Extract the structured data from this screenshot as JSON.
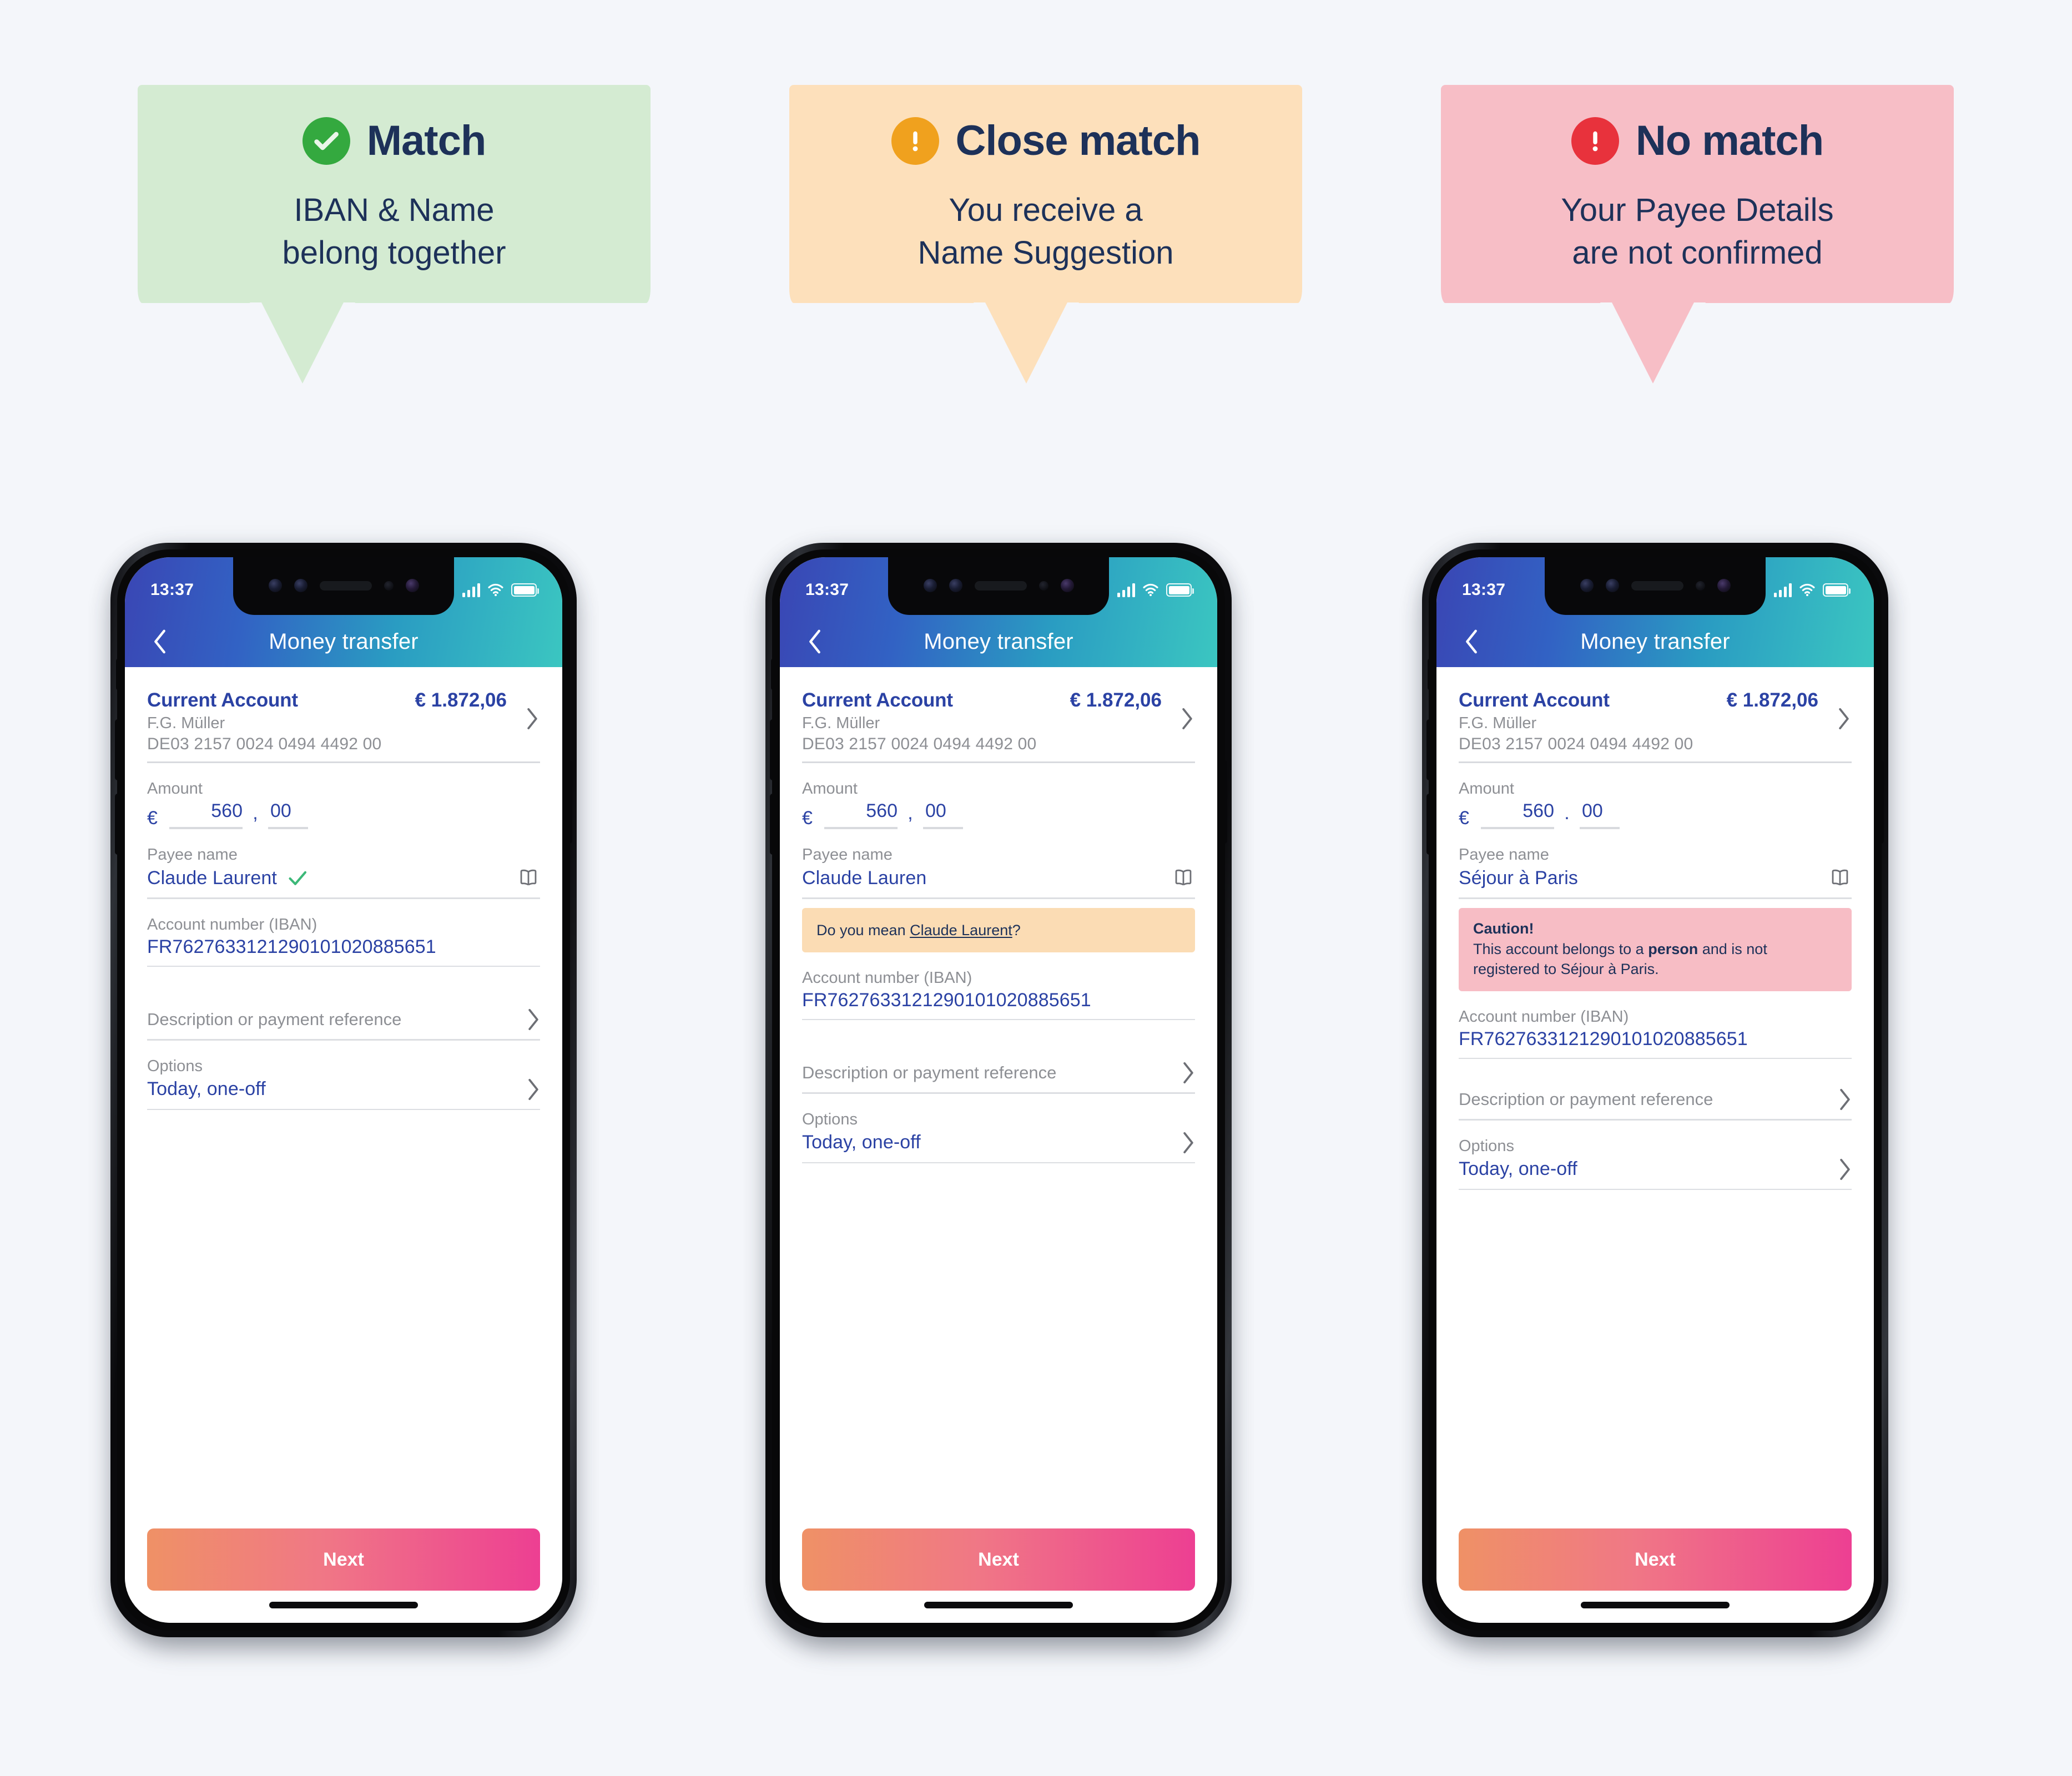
{
  "page": {
    "background_color": "#f4f6fa"
  },
  "callouts": [
    {
      "id": "match",
      "title": "Match",
      "subtitle_line1": "IBAN & Name",
      "subtitle_line2": "belong together",
      "icon": "check-circle-icon",
      "badge_color": "#34a93f",
      "panel_color": "#d4ebd2",
      "text_color": "#1d3159"
    },
    {
      "id": "close-match",
      "title": "Close match",
      "subtitle_line1": "You receive a",
      "subtitle_line2": "Name Suggestion",
      "icon": "exclamation-circle-icon",
      "badge_color": "#f0a11e",
      "panel_color": "#fde0bb",
      "text_color": "#1d3159"
    },
    {
      "id": "no-match",
      "title": "No match",
      "subtitle_line1": "Your Payee Details",
      "subtitle_line2": "are not confirmed",
      "icon": "exclamation-circle-icon",
      "badge_color": "#e8323c",
      "panel_color": "#f7bec6",
      "text_color": "#1d3159"
    }
  ],
  "phones": [
    {
      "id": "phone-match",
      "status_bar": {
        "time": "13:37",
        "signal_icon": "cellular-signal-icon",
        "wifi_icon": "wifi-icon",
        "battery_icon": "battery-full-icon"
      },
      "header": {
        "back_icon": "chevron-left-icon",
        "title": "Money transfer"
      },
      "account": {
        "name": "Current Account",
        "balance": "€ 1.872,06",
        "holder": "F.G. Müller",
        "iban": "DE03 2157 0024 0494 4492 00",
        "chevron_icon": "chevron-right-icon"
      },
      "amount": {
        "label": "Amount",
        "currency": "€",
        "integer": "560",
        "separator": ",",
        "decimals": "00"
      },
      "payee": {
        "label": "Payee name",
        "value": "Claude Laurent",
        "status_icon": "check-icon",
        "status_icon_color": "#3cb878",
        "addressbook_icon": "open-book-icon"
      },
      "alert": null,
      "iban_field": {
        "label": "Account number (IBAN)",
        "value": "FR7627633121290101020885651"
      },
      "description_field": {
        "placeholder": "Description or payment reference",
        "chevron_icon": "chevron-right-icon"
      },
      "options_field": {
        "label": "Options",
        "value": "Today, one-off",
        "chevron_icon": "chevron-right-icon"
      },
      "primary_button": "Next"
    },
    {
      "id": "phone-close-match",
      "status_bar": {
        "time": "13:37",
        "signal_icon": "cellular-signal-icon",
        "wifi_icon": "wifi-icon",
        "battery_icon": "battery-full-icon"
      },
      "header": {
        "back_icon": "chevron-left-icon",
        "title": "Money transfer"
      },
      "account": {
        "name": "Current Account",
        "balance": "€ 1.872,06",
        "holder": "F.G. Müller",
        "iban": "DE03 2157 0024 0494 4492 00",
        "chevron_icon": "chevron-right-icon"
      },
      "amount": {
        "label": "Amount",
        "currency": "€",
        "integer": "560",
        "separator": ",",
        "decimals": "00"
      },
      "payee": {
        "label": "Payee name",
        "value": "Claude Lauren",
        "status_icon": null,
        "status_icon_color": null,
        "addressbook_icon": "open-book-icon"
      },
      "alert": {
        "type": "suggestion",
        "background_color": "#fbdcb4",
        "prefix": "Do you mean ",
        "suggestion": "Claude Laurent",
        "suffix": "?"
      },
      "iban_field": {
        "label": "Account number (IBAN)",
        "value": "FR7627633121290101020885651"
      },
      "description_field": {
        "placeholder": "Description or payment reference",
        "chevron_icon": "chevron-right-icon"
      },
      "options_field": {
        "label": "Options",
        "value": "Today, one-off",
        "chevron_icon": "chevron-right-icon"
      },
      "primary_button": "Next"
    },
    {
      "id": "phone-no-match",
      "status_bar": {
        "time": "13:37",
        "signal_icon": "cellular-signal-icon",
        "wifi_icon": "wifi-icon",
        "battery_icon": "battery-full-icon"
      },
      "header": {
        "back_icon": "chevron-left-icon",
        "title": "Money transfer"
      },
      "account": {
        "name": "Current Account",
        "balance": "€ 1.872,06",
        "holder": "F.G. Müller",
        "iban": "DE03 2157 0024 0494 4492 00",
        "chevron_icon": "chevron-right-icon"
      },
      "amount": {
        "label": "Amount",
        "currency": "€",
        "integer": "560",
        "separator": ".",
        "decimals": "00"
      },
      "payee": {
        "label": "Payee name",
        "value": "Séjour à Paris",
        "status_icon": null,
        "status_icon_color": null,
        "addressbook_icon": "open-book-icon"
      },
      "alert": {
        "type": "caution",
        "background_color": "#f7bdc5",
        "title": "Caution!",
        "body_part1": "This account belongs to a ",
        "body_bold": "person",
        "body_part2": " and is not registered to Séjour à Paris."
      },
      "iban_field": {
        "label": "Account number (IBAN)",
        "value": "FR7627633121290101020885651"
      },
      "description_field": {
        "placeholder": "Description or payment reference",
        "chevron_icon": "chevron-right-icon"
      },
      "options_field": {
        "label": "Options",
        "value": "Today, one-off",
        "chevron_icon": "chevron-right-icon"
      },
      "primary_button": "Next"
    }
  ]
}
